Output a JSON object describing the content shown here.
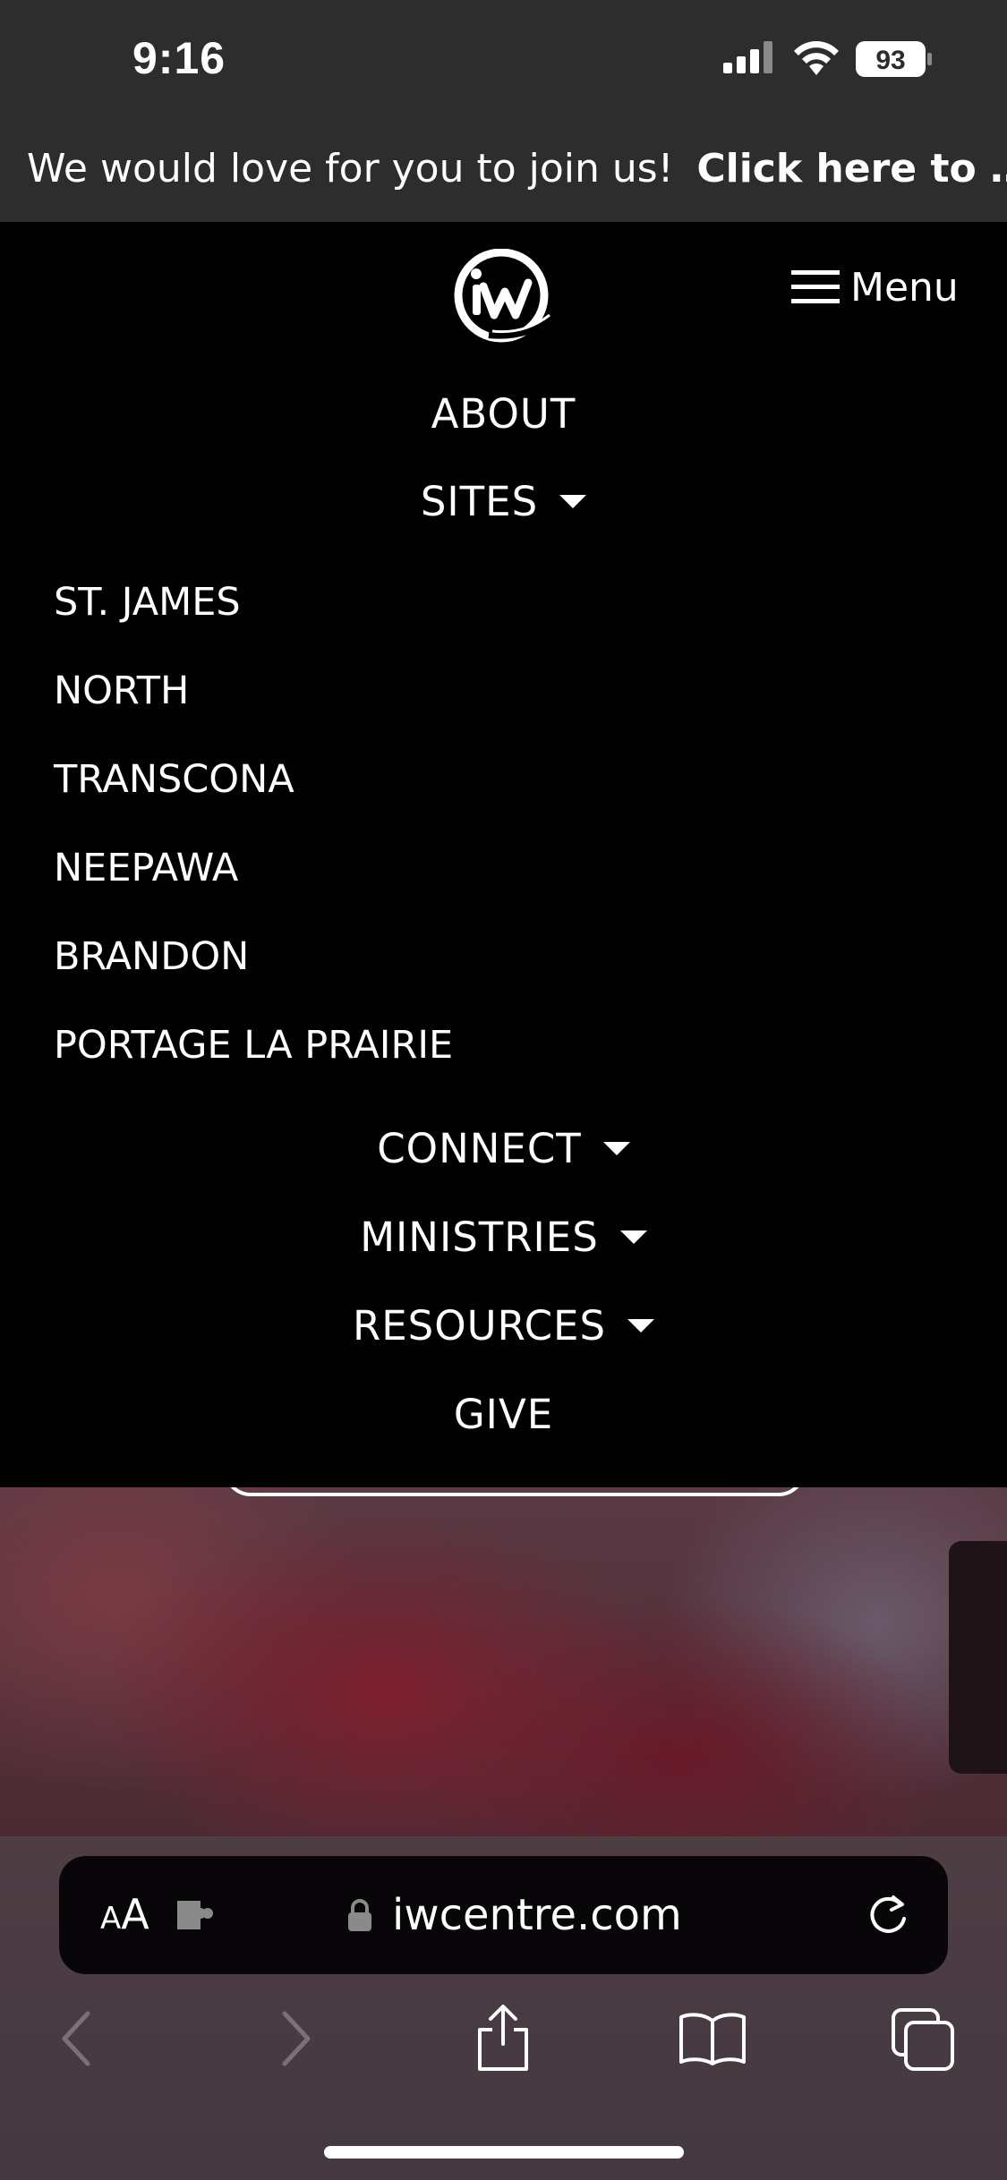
{
  "status_bar": {
    "time": "9:16",
    "battery": "93"
  },
  "announcement": {
    "text": "We would love for you to join us!",
    "cta": "Click here to …"
  },
  "nav": {
    "logo_icon": "iw-logo-icon",
    "menu_label": "Menu",
    "items": [
      {
        "label": "ABOUT",
        "has_dropdown": false
      },
      {
        "label": "SITES",
        "has_dropdown": true,
        "expanded": true
      },
      {
        "label": "CONNECT",
        "has_dropdown": true
      },
      {
        "label": "MINISTRIES",
        "has_dropdown": true
      },
      {
        "label": "RESOURCES",
        "has_dropdown": true
      },
      {
        "label": "GIVE",
        "has_dropdown": false
      }
    ],
    "sites": [
      "ST. JAMES",
      "NORTH",
      "TRANSCONA",
      "NEEPAWA",
      "BRANDON",
      "PORTAGE LA PRAIRIE"
    ]
  },
  "browser": {
    "text_size_small": "A",
    "text_size_big": "A",
    "url": "iwcentre.com",
    "toolbar": [
      "back-icon",
      "forward-icon",
      "share-icon",
      "bookmarks-icon",
      "tabs-icon"
    ]
  },
  "colors": {
    "status_bg": "#2d2d2d",
    "nav_bg": "#000000",
    "text": "#ffffff"
  }
}
